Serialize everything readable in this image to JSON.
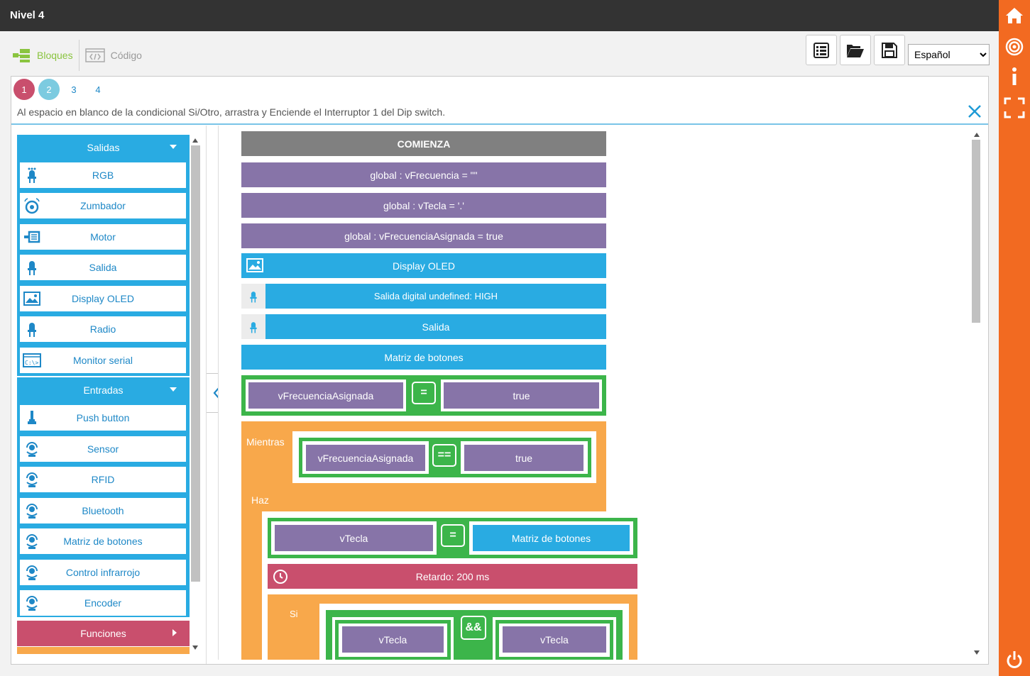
{
  "window": {
    "title": "Nivel 4"
  },
  "tabs": [
    {
      "label": "Bloques"
    },
    {
      "label": "Código"
    }
  ],
  "language": {
    "selected": "Español"
  },
  "steps": [
    "1",
    "2",
    "3",
    "4"
  ],
  "instruction": "Al espacio en blanco de la condicional Si/Otro, arrastra y Enciende el Interruptor 1 del Dip switch.",
  "toolbox": {
    "outputs": {
      "label": "Salidas",
      "items": [
        "RGB",
        "Zumbador",
        "Motor",
        "Salida",
        "Display OLED",
        "Radio",
        "Monitor serial"
      ]
    },
    "inputs": {
      "label": "Entradas",
      "items": [
        "Push button",
        "Sensor",
        "RFID",
        "Bluetooth",
        "Matriz de botones",
        "Control infrarrojo",
        "Encoder"
      ]
    },
    "functions": {
      "label": "Funciones"
    }
  },
  "program": {
    "start": "COMIENZA",
    "globals": [
      "global : vFrecuencia = \"\"",
      "global : vTecla = '.'",
      "global : vFrecuenciaAsignada = true"
    ],
    "display_oled": "Display OLED",
    "digital_out": "Salida digital undefined: HIGH",
    "salida": "Salida",
    "matrix": "Matriz de botones",
    "assign1": {
      "left": "vFrecuenciaAsignada",
      "op": "=",
      "right": "true"
    },
    "while_label": "Mientras",
    "while_cond": {
      "left": "vFrecuenciaAsignada",
      "op": "==",
      "right": "true"
    },
    "do_label": "Haz",
    "assign2": {
      "left": "vTecla",
      "op": "=",
      "right": "Matriz de botones"
    },
    "delay": "Retardo: 200 ms",
    "if_label": "Si",
    "if_cond": {
      "left": "vTecla",
      "op": "&&",
      "right": "vTecla"
    }
  },
  "colors": {
    "accent": "#f26a21",
    "purple": "#8774a8",
    "blue": "#29abe2",
    "green": "#3cb54a",
    "orange": "#f8a84b",
    "red": "#c94f6d"
  }
}
